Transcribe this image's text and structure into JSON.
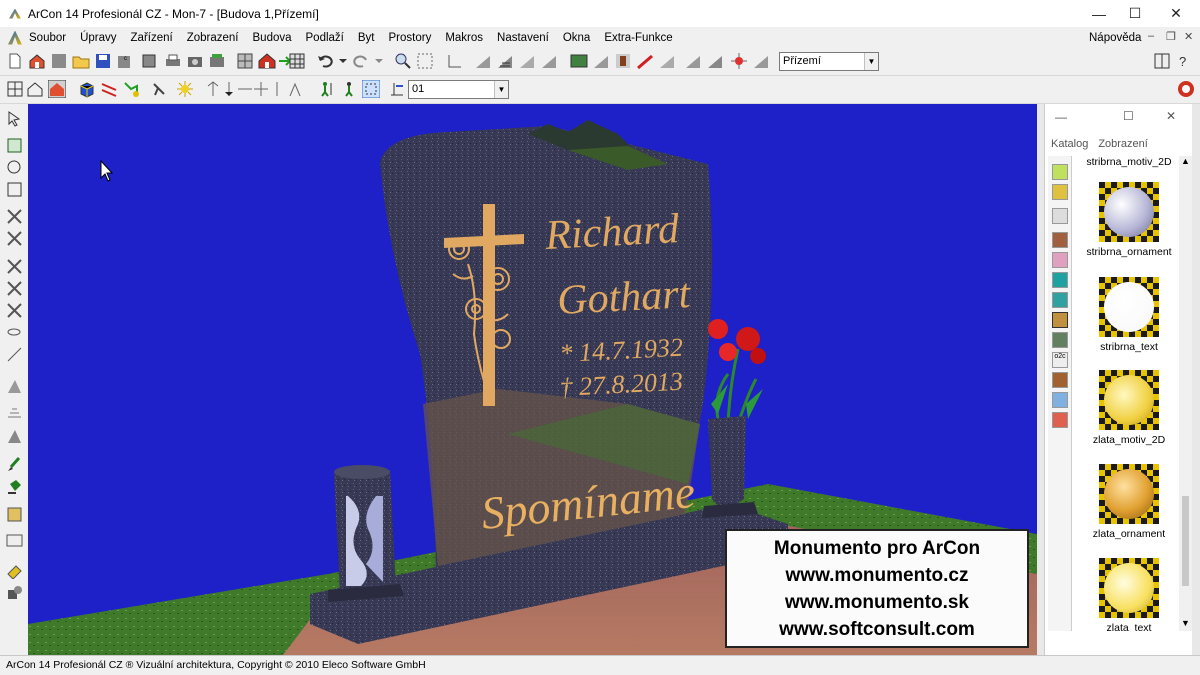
{
  "window": {
    "title": "ArCon 14 Profesionál CZ - Mon-7 - [Budova 1,Přízemí]",
    "minimize": "—",
    "maximize": "☐",
    "close": "✕"
  },
  "menu": {
    "items": [
      "Soubor",
      "Úpravy",
      "Zařízení",
      "Zobrazení",
      "Budova",
      "Podlaží",
      "Byt",
      "Prostory",
      "Makros",
      "Nastavení",
      "Okna",
      "Extra-Funkce"
    ],
    "help": "Nápověda"
  },
  "toolbar1": {
    "floor_combo": "Přízemí"
  },
  "toolbar2": {
    "level_combo": "01"
  },
  "viewport": {
    "monument": {
      "name_line1": "Richard",
      "name_line2": "Gothart",
      "date_birth": "* 14.7.1932",
      "date_death": "† 27.8.2013",
      "inscription": "Spomíname"
    },
    "ad": {
      "line1": "Monumento pro ArCon",
      "line2": "www.monumento.cz",
      "line3": "www.monumento.sk",
      "line4": "www.softconsult.com"
    }
  },
  "catalog": {
    "tabs": [
      "Katalog",
      "Zobrazení"
    ],
    "items": [
      {
        "label": "stribrna_motiv_2D"
      },
      {
        "label": "stribrna_ornament",
        "color": "#c8c8e0"
      },
      {
        "label": "stribrna_text",
        "color": "#ffffff"
      },
      {
        "label": "zlata_motiv_2D",
        "color": "#f5e050"
      },
      {
        "label": "zlata_ornament",
        "color": "#e0a030"
      },
      {
        "label": "zlata_text",
        "color": "#f8e060"
      }
    ]
  },
  "status": {
    "text": "ArCon 14 Profesionál CZ ® Vizuální architektura, Copyright © 2010 Eleco Software GmbH"
  },
  "colors": {
    "background_sky": "#1e20c8",
    "granite": "#3a3a52",
    "gold": "#e8b060"
  }
}
